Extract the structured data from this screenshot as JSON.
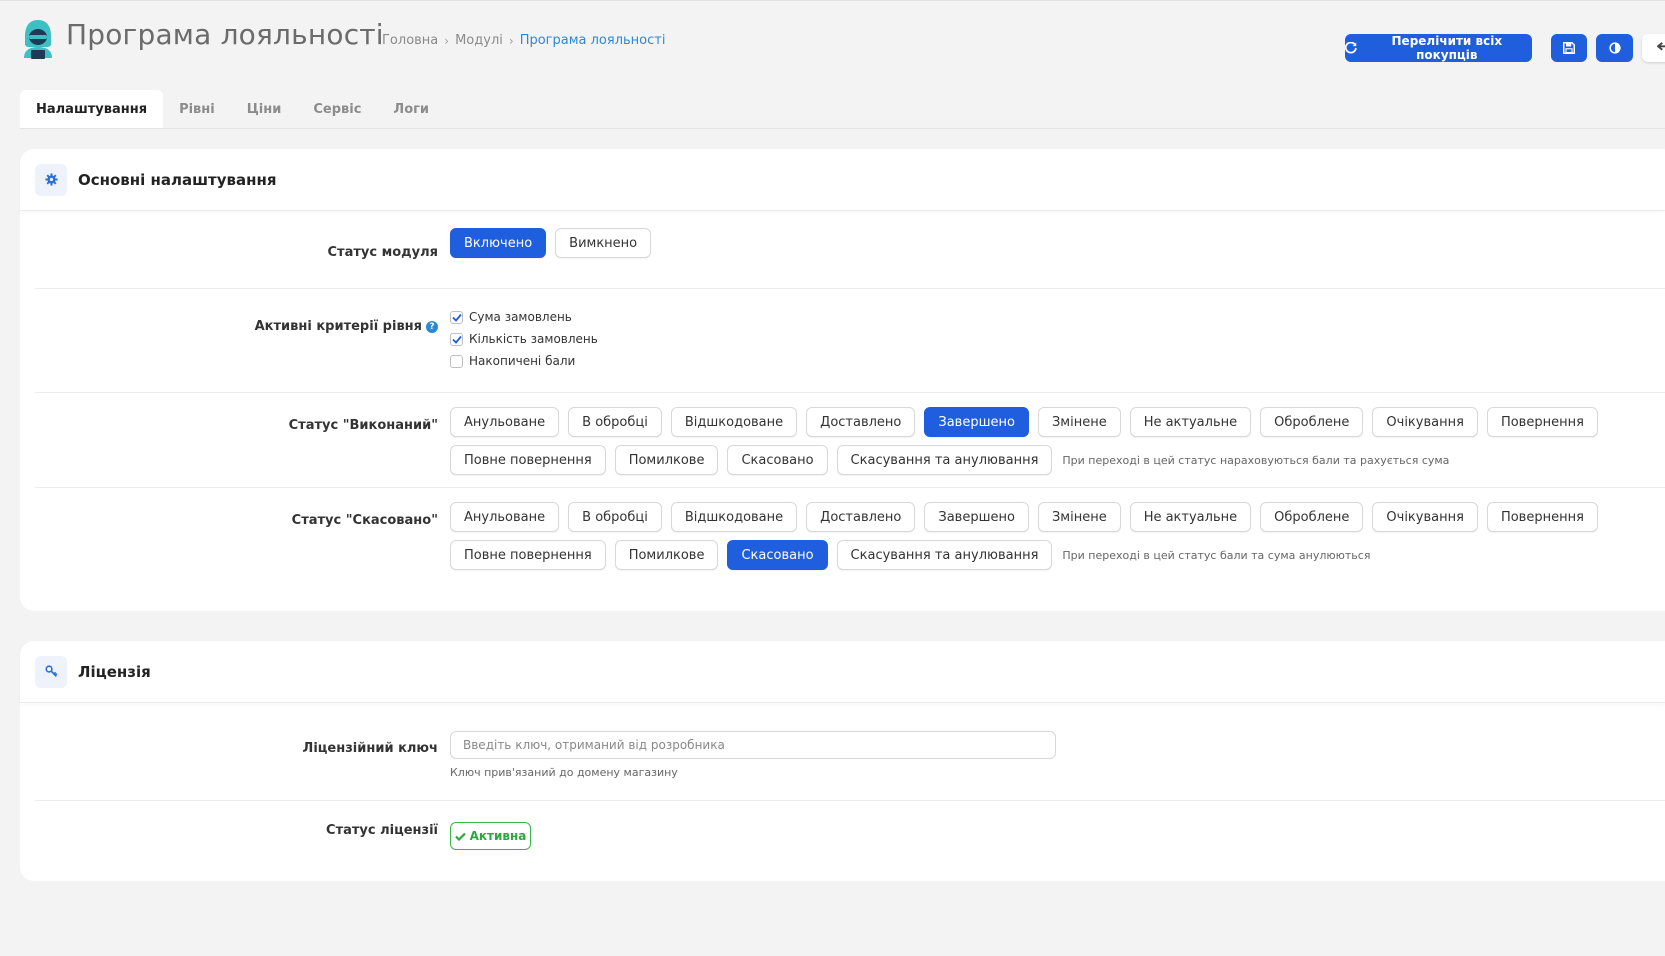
{
  "header": {
    "title": "Програма лояльності",
    "breadcrumb": [
      "Головна",
      "Модулі",
      "Програма лояльності"
    ],
    "recalc_label": "Перелічити всіх покупців"
  },
  "tabs": [
    "Налаштування",
    "Рівні",
    "Ціни",
    "Сервіс",
    "Логи"
  ],
  "main_section": {
    "title": "Основні налаштування",
    "module_status": {
      "label": "Статус модуля",
      "options": [
        "Включено",
        "Вимкнено"
      ],
      "selected": "Включено"
    },
    "criteria": {
      "label": "Активні критерії рівня",
      "items": [
        {
          "label": "Сума замовлень",
          "checked": true
        },
        {
          "label": "Кількість замовлень",
          "checked": true
        },
        {
          "label": "Накопичені бали",
          "checked": false
        }
      ]
    },
    "status_done": {
      "label": "Статус \"Виконаний\"",
      "row1": [
        "Анульоване",
        "В обробці",
        "Відшкодоване",
        "Доставлено",
        "Завершено",
        "Змінене",
        "Не актуальне",
        "Оброблене",
        "Очікування",
        "Повернення"
      ],
      "row2": [
        "Повне повернення",
        "Помилкове",
        "Скасовано",
        "Скасування та анулювання"
      ],
      "selected": "Завершено",
      "hint": "При переході в цей статус нараховуються бали та рахується сума"
    },
    "status_cancel": {
      "label": "Статус \"Скасовано\"",
      "row1": [
        "Анульоване",
        "В обробці",
        "Відшкодоване",
        "Доставлено",
        "Завершено",
        "Змінене",
        "Не актуальне",
        "Оброблене",
        "Очікування",
        "Повернення"
      ],
      "row2": [
        "Повне повернення",
        "Помилкове",
        "Скасовано",
        "Скасування та анулювання"
      ],
      "selected": "Скасовано",
      "hint": "При переході в цей статус бали та сума анулюються"
    }
  },
  "license_section": {
    "title": "Ліцензія",
    "key_label": "Ліцензійний ключ",
    "key_value": "",
    "key_placeholder": "Введіть ключ, отриманий від розробника",
    "key_help": "Ключ прив'язаний до домену магазину",
    "status_label": "Статус ліцензії",
    "status_value": "Активна"
  },
  "colors": {
    "primary": "#1f5edc",
    "link": "#2b8ad6",
    "success": "#2fa63e",
    "logo": "#3cc0c4"
  },
  "icons": [
    "logo-hacker-icon",
    "refresh-icon",
    "save-icon",
    "contrast-icon",
    "back-arrow-icon",
    "gear-icon",
    "key-icon",
    "question-icon",
    "check-icon"
  ]
}
